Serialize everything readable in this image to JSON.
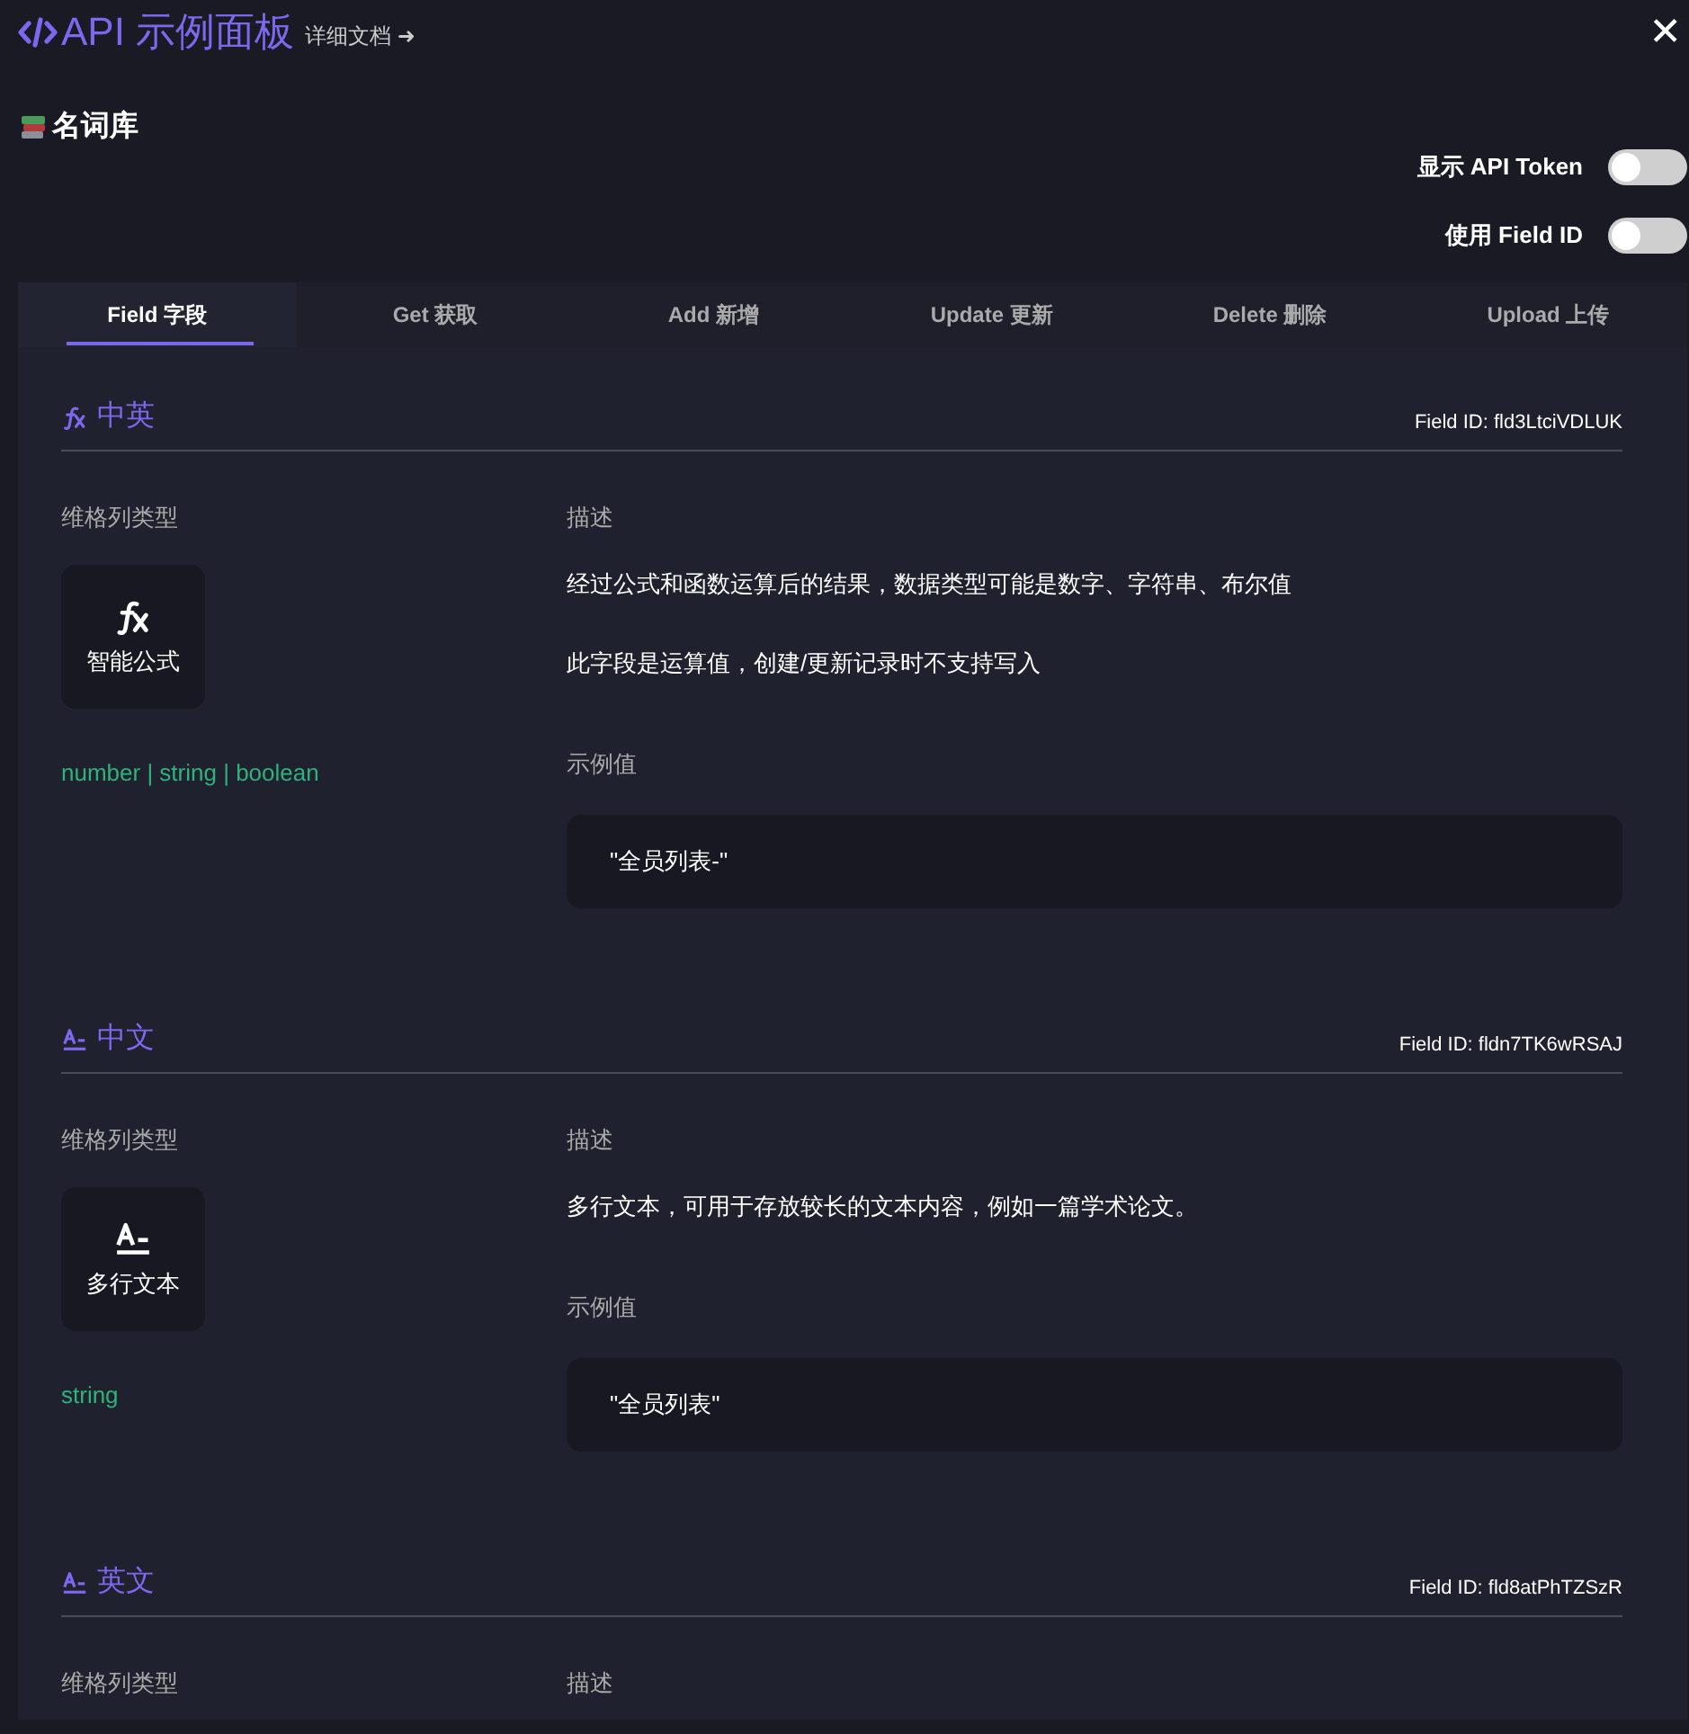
{
  "header": {
    "title": "API 示例面板",
    "docs_link": "详细文档 ➜",
    "close": "✕"
  },
  "sheet": {
    "name": "名词库"
  },
  "toggles": [
    {
      "label": "显示 API Token",
      "on": false
    },
    {
      "label": "使用 Field ID",
      "on": false
    }
  ],
  "tabs": [
    {
      "label": "Field 字段",
      "selected": true
    },
    {
      "label": "Get 获取",
      "selected": false
    },
    {
      "label": "Add 新增",
      "selected": false
    },
    {
      "label": "Update 更新",
      "selected": false
    },
    {
      "label": "Delete 删除",
      "selected": false
    },
    {
      "label": "Upload 上传",
      "selected": false
    }
  ],
  "fields": [
    {
      "kind": "formula",
      "name": "中英",
      "field_id": "Field ID: fld3LtciVDLUK",
      "type_heading": "维格列类型",
      "type_name": "智能公式",
      "value_type": "number | string | boolean",
      "description_heading": "描述",
      "descriptions": [
        "经过公式和函数运算后的结果，数据类型可能是数字、字符串、布尔值",
        "此字段是运算值，创建/更新记录时不支持写入"
      ],
      "example_heading": "示例值",
      "example": "\"全员列表-\""
    },
    {
      "kind": "text",
      "name": "中文",
      "field_id": "Field ID: fldn7TK6wRSAJ",
      "type_heading": "维格列类型",
      "type_name": "多行文本",
      "value_type": "string",
      "description_heading": "描述",
      "descriptions": [
        "多行文本，可用于存放较长的文本内容，例如一篇学术论文。"
      ],
      "example_heading": "示例值",
      "example": "\"全员列表\""
    },
    {
      "kind": "text",
      "name": "英文",
      "field_id": "Field ID: fld8atPhTZSzR",
      "type_heading": "维格列类型",
      "description_heading": "描述"
    }
  ]
}
